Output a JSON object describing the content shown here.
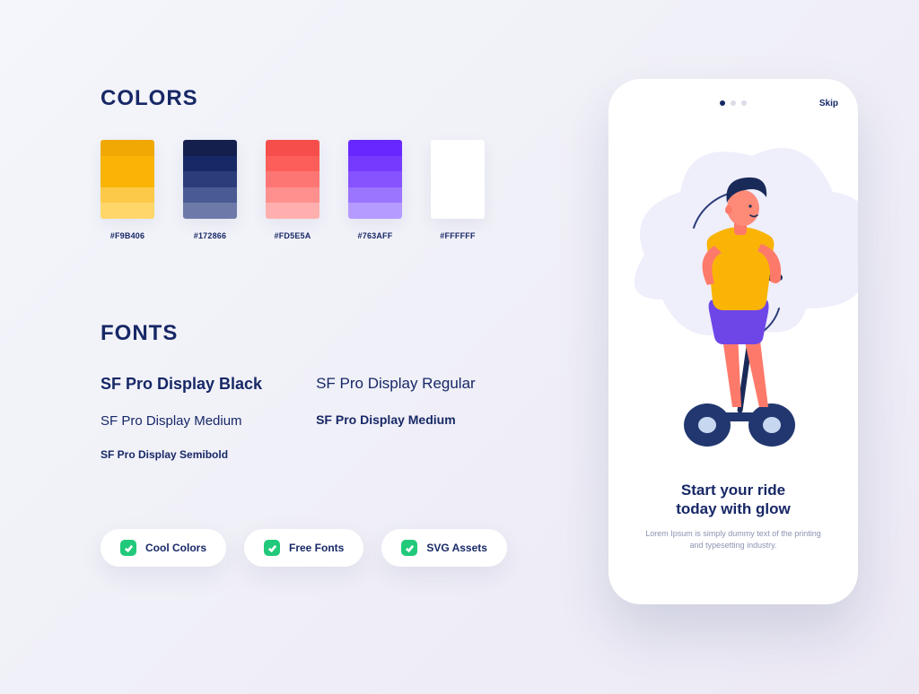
{
  "sections": {
    "colors_title": "COLORS",
    "fonts_title": "FONTS"
  },
  "colors": [
    {
      "hex": "#F9B406",
      "shades": [
        "#F0A804",
        "#F9B406",
        "#F9B406",
        "#FDC948",
        "#FFD66A"
      ]
    },
    {
      "hex": "#172866",
      "shades": [
        "#141F4D",
        "#172866",
        "#2B3C7A",
        "#4A5A93",
        "#6D7AA9"
      ]
    },
    {
      "hex": "#FD5E5A",
      "shades": [
        "#F64F4B",
        "#FD5E5A",
        "#FE7673",
        "#FF908E",
        "#FFB0AE"
      ]
    },
    {
      "hex": "#763AFF",
      "shades": [
        "#6827FF",
        "#763AFF",
        "#8653FF",
        "#9B74FF",
        "#B59AFF"
      ]
    },
    {
      "hex": "#FFFFFF",
      "shades": [
        "#FFFFFF",
        "#FFFFFF",
        "#FFFFFF",
        "#FFFFFF",
        "#FFFFFF"
      ]
    }
  ],
  "fonts": {
    "col1": [
      "SF Pro Display Black",
      "SF Pro Display Medium",
      "SF Pro Display Semibold"
    ],
    "col2": [
      "SF Pro Display Regular",
      "SF Pro Display Medium"
    ]
  },
  "pills": [
    "Cool Colors",
    "Free Fonts",
    "SVG Assets"
  ],
  "phone": {
    "skip": "Skip",
    "title_line1": "Start your ride",
    "title_line2": "today with glow",
    "subtitle": "Lorem Ipsum is simply dummy text of the printing and typesetting industry.",
    "dots_total": 3,
    "active_dot": 0
  }
}
